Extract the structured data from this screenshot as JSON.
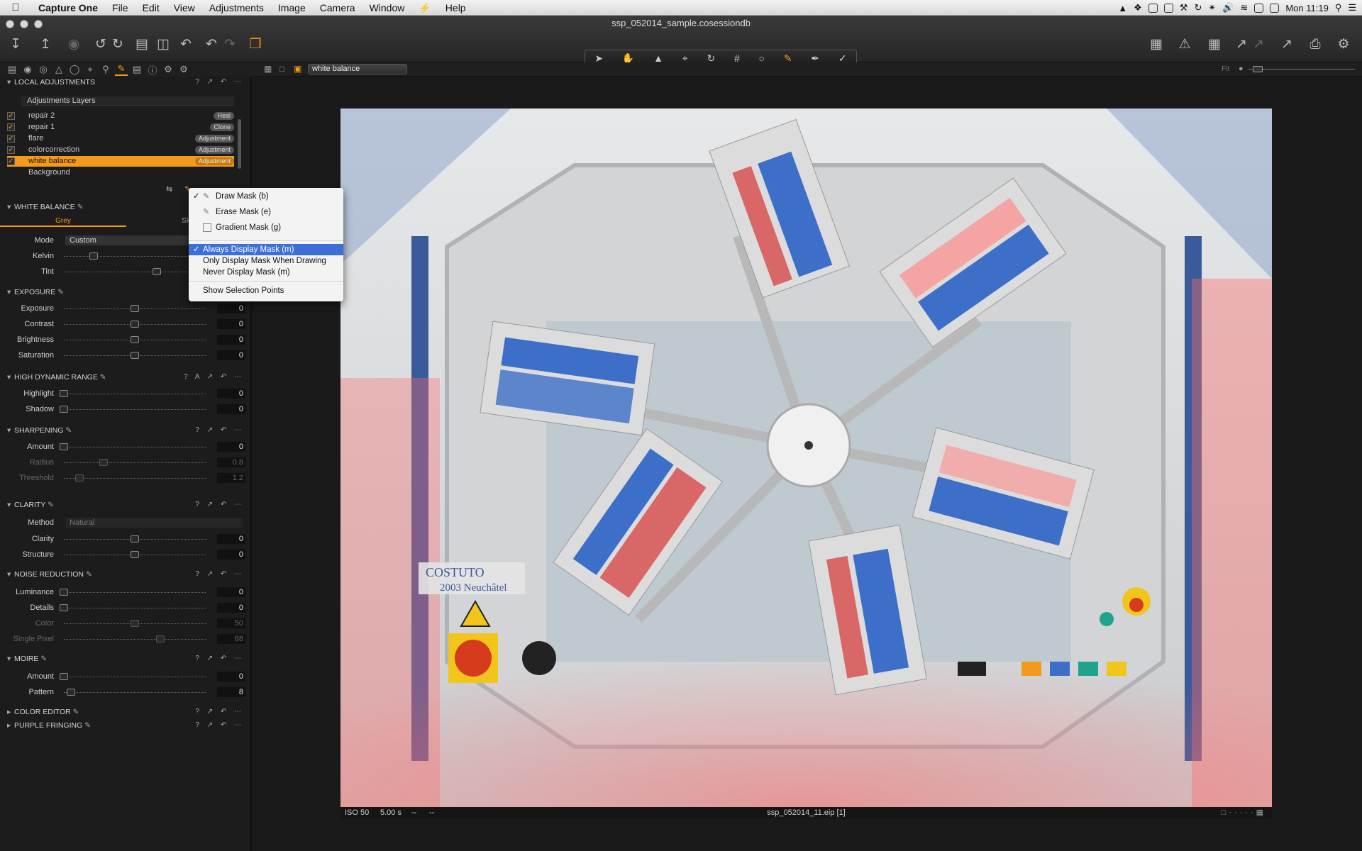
{
  "menubar": {
    "apple": "",
    "app_name": "Capture One",
    "items": [
      "File",
      "Edit",
      "View",
      "Adjustments",
      "Image",
      "Camera",
      "Window",
      "⚡",
      "Help"
    ],
    "clock": "Mon 11:19"
  },
  "window": {
    "title": "ssp_052014_sample.cosessiondb"
  },
  "viewer_toolbar": {
    "style_select": "white balance",
    "fit_label": "Fit"
  },
  "local_adjustments": {
    "title": "LOCAL ADJUSTMENTS",
    "layers_header": "Adjustments Layers",
    "layers": [
      {
        "name": "repair 2",
        "tag": "Heal",
        "checked": true,
        "selected": false
      },
      {
        "name": "repair 1",
        "tag": "Clone",
        "checked": true,
        "selected": false
      },
      {
        "name": "flare",
        "tag": "Adjustment",
        "checked": true,
        "selected": false
      },
      {
        "name": "colorcorrection",
        "tag": "Adjustment",
        "checked": true,
        "selected": false
      },
      {
        "name": "white balance",
        "tag": "Adjustment",
        "checked": true,
        "selected": true
      },
      {
        "name": "Background",
        "tag": "",
        "checked": false,
        "selected": false
      }
    ]
  },
  "white_balance": {
    "title": "WHITE BALANCE",
    "tab_grey": "Grey",
    "tab_skin": "Skin",
    "mode_label": "Mode",
    "mode_value": "Custom",
    "kelvin_label": "Kelvin",
    "tint_label": "Tint"
  },
  "exposure": {
    "title": "EXPOSURE",
    "rows": [
      {
        "label": "Exposure",
        "value": "0"
      },
      {
        "label": "Contrast",
        "value": "0"
      },
      {
        "label": "Brightness",
        "value": "0"
      },
      {
        "label": "Saturation",
        "value": "0"
      }
    ]
  },
  "hdr": {
    "title": "HIGH DYNAMIC RANGE",
    "rows": [
      {
        "label": "Highlight",
        "value": "0"
      },
      {
        "label": "Shadow",
        "value": "0"
      }
    ]
  },
  "sharpening": {
    "title": "SHARPENING",
    "rows": [
      {
        "label": "Amount",
        "value": "0"
      },
      {
        "label": "Radius",
        "value": "0.8"
      },
      {
        "label": "Threshold",
        "value": "1.2"
      }
    ]
  },
  "clarity": {
    "title": "CLARITY",
    "method_label": "Method",
    "method_value": "Natural",
    "rows": [
      {
        "label": "Clarity",
        "value": "0"
      },
      {
        "label": "Structure",
        "value": "0"
      }
    ]
  },
  "noise_reduction": {
    "title": "NOISE REDUCTION",
    "rows": [
      {
        "label": "Luminance",
        "value": "0"
      },
      {
        "label": "Details",
        "value": "0"
      },
      {
        "label": "Color",
        "value": "50"
      },
      {
        "label": "Single Pixel",
        "value": "68"
      }
    ]
  },
  "moire": {
    "title": "MOIRE",
    "rows": [
      {
        "label": "Amount",
        "value": "0"
      },
      {
        "label": "Pattern",
        "value": "8"
      }
    ]
  },
  "collapsed_sections": [
    "COLOR EDITOR",
    "PURPLE FRINGING"
  ],
  "mask_menu": {
    "items": [
      {
        "label": "Draw Mask (b)",
        "checked": true,
        "icon": "brush-icon"
      },
      {
        "label": "Erase Mask (e)",
        "checked": false,
        "icon": "eraser-icon"
      },
      {
        "label": "Gradient Mask (g)",
        "checked": false,
        "icon": "gradient-icon"
      }
    ],
    "display_items": [
      {
        "label": "Always Display Mask (m)",
        "checked": true,
        "highlighted": true
      },
      {
        "label": "Only Display Mask When Drawing",
        "checked": false,
        "highlighted": false
      },
      {
        "label": "Never Display Mask (m)",
        "checked": false,
        "highlighted": false
      }
    ],
    "extra": "Show Selection Points"
  },
  "image": {
    "plate_brand": "COSTUTO",
    "plate_line2": "2003 Neuchâtel"
  },
  "caption": {
    "iso": "ISO 50",
    "shutter": "5.00 s",
    "aperture": "--",
    "focal": "--",
    "filename": "ssp_052014_11.eip [1]"
  },
  "colors": {
    "accent": "#f39a1d",
    "menu_highlight": "#3d6fd9",
    "mask_overlay": "#ff6b6b"
  }
}
